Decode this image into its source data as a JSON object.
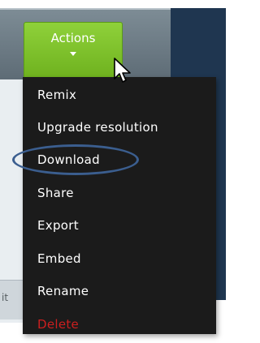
{
  "actions_button": {
    "label": "Actions"
  },
  "menu": {
    "items": [
      {
        "label": "Remix"
      },
      {
        "label": "Upgrade resolution"
      },
      {
        "label": "Download"
      },
      {
        "label": "Share"
      },
      {
        "label": "Export"
      },
      {
        "label": "Embed"
      },
      {
        "label": "Rename"
      },
      {
        "label": "Delete"
      }
    ]
  },
  "background": {
    "tab_fragment": "it"
  },
  "colors": {
    "button_green": "#7cc22a",
    "menu_bg": "#1b1b1b",
    "menu_text": "#ffffff",
    "delete_red": "#cc1f1f",
    "highlight_blue": "#3b5e8f",
    "navy_panel": "#1f3650"
  },
  "icons": {
    "button_caret": "caret-down-icon",
    "pointer": "mouse-pointer-icon"
  }
}
